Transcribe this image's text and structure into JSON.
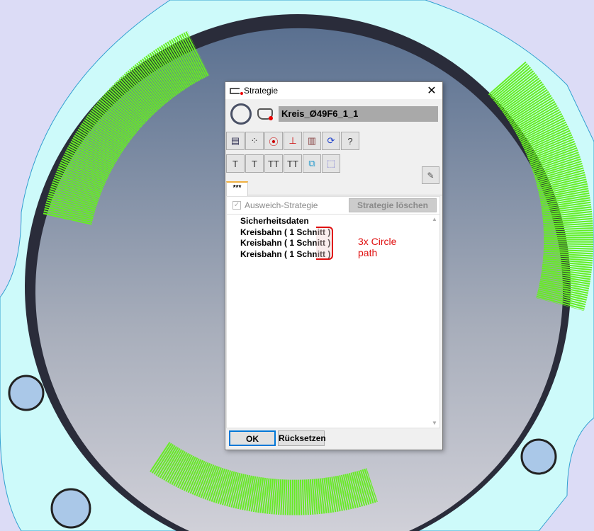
{
  "dialog": {
    "title": "Strategie",
    "name": "Kreis_Ø49F6_1_1",
    "tab": "***",
    "fallback_label": "Ausweich-Strategie",
    "fallback_checked": true,
    "delete_label": "Strategie löschen",
    "items": [
      "Sicherheitsdaten",
      "Kreisbahn  ( 1 Schnitt )",
      "Kreisbahn  ( 1 Schnitt )",
      "Kreisbahn  ( 1 Schnitt )"
    ],
    "annotation": "3x Circle path",
    "ok_label": "OK",
    "reset_label": "Rücksetzen",
    "toolbar1": [
      "list-icon",
      "points-icon",
      "circle-points-icon",
      "probe-icon",
      "cylinder-icon",
      "rotate-cube-icon",
      "curve-question-icon"
    ],
    "toolbar2": [
      "t-axis-icon",
      "t-plane-icon",
      "t-double-icon",
      "t-surface-icon",
      "align-icon",
      "wire-cube-icon"
    ]
  },
  "colors": {
    "background": "#dcdcf6",
    "plate": "#cdfafa",
    "toolpath": "#66ee22",
    "annotation": "#e01010"
  }
}
